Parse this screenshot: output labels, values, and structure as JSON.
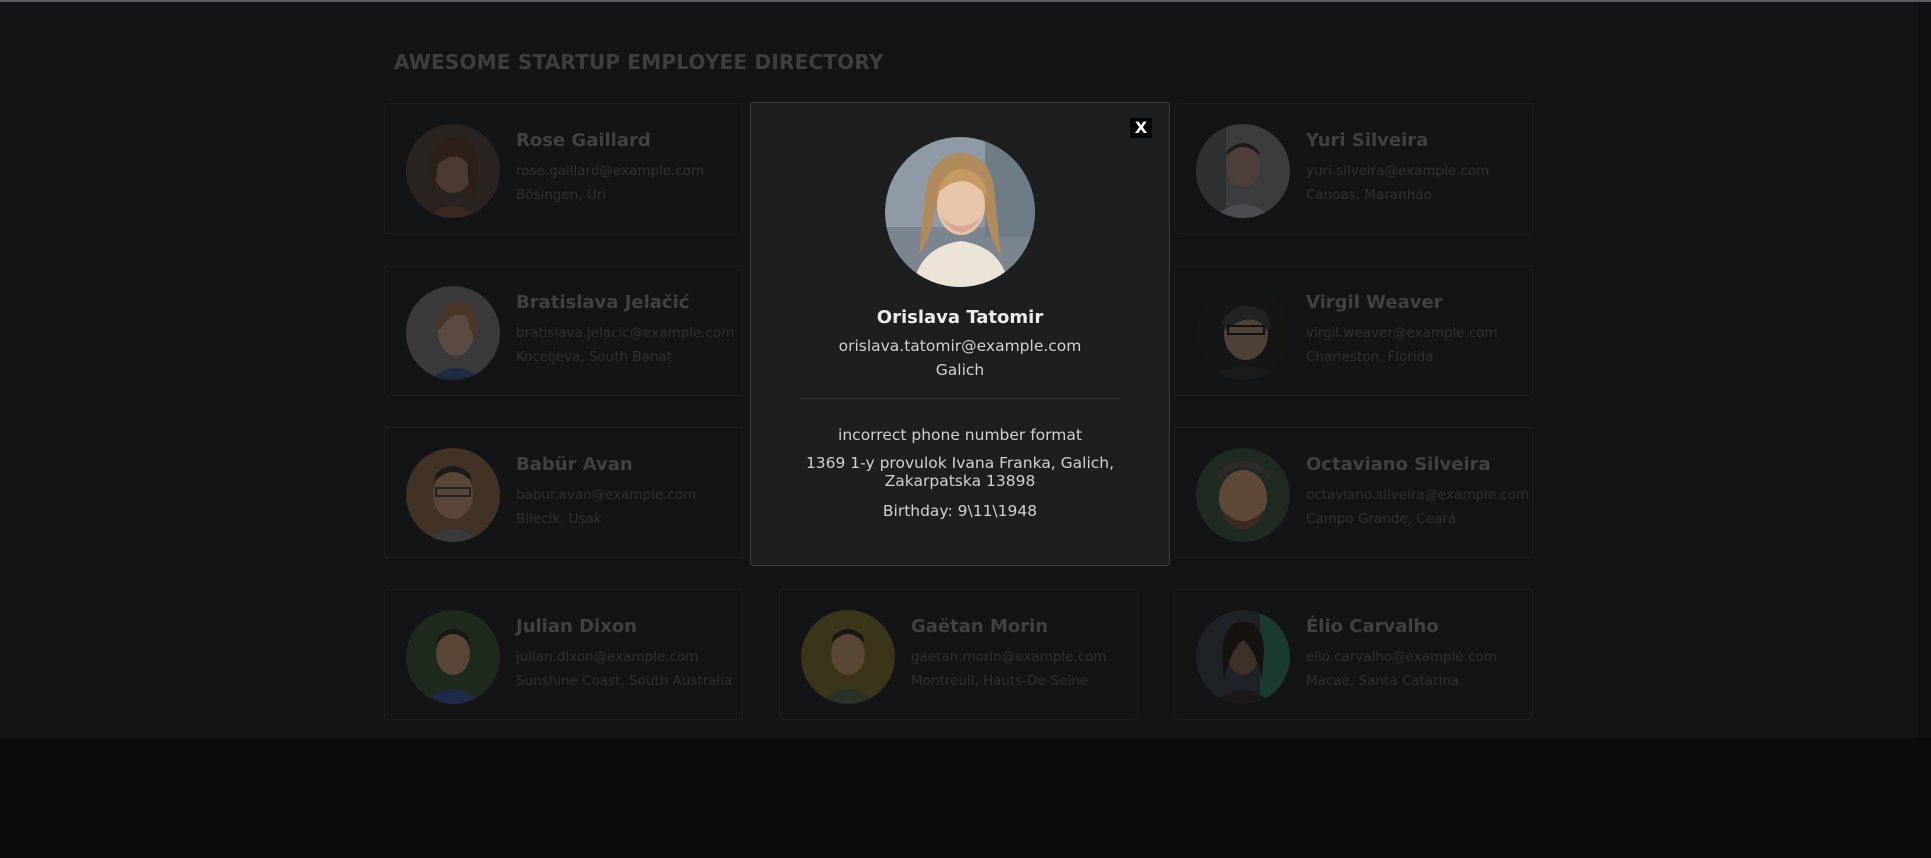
{
  "header": {
    "title": "AWESOME STARTUP EMPLOYEE DIRECTORY"
  },
  "employees": [
    {
      "name": "Rose Gaillard",
      "email": "rose.gaillard@example.com",
      "location": "Bösingen, Uri"
    },
    {
      "name": "",
      "email": "",
      "location": ""
    },
    {
      "name": "Yuri Silveira",
      "email": "yuri.silveira@example.com",
      "location": "Canoas, Maranhão"
    },
    {
      "name": "Bratislava Jelačić",
      "email": "bratislava.jelacic@example.com",
      "location": "Koceljeva, South Banat"
    },
    {
      "name": "",
      "email": "",
      "location": ""
    },
    {
      "name": "Virgil Weaver",
      "email": "virgil.weaver@example.com",
      "location": "Charleston, Florida"
    },
    {
      "name": "Babür Avan",
      "email": "babur.avan@example.com",
      "location": "Bilecik, Uşak"
    },
    {
      "name": "",
      "email": "",
      "location": ""
    },
    {
      "name": "Octaviano Silveira",
      "email": "octaviano.silveira@example.com",
      "location": "Campo Grande, Ceará"
    },
    {
      "name": "Julian Dixon",
      "email": "julian.dixon@example.com",
      "location": "Sunshine Coast, South Australia"
    },
    {
      "name": "Gaëtan Morin",
      "email": "gaetan.morin@example.com",
      "location": "Montreuil, Hauts-De-Seine"
    },
    {
      "name": "Élio Carvalho",
      "email": "elio.carvalho@example.com",
      "location": "Macaé, Santa Catarina"
    }
  ],
  "modal": {
    "close_label": "X",
    "name": "Orislava Tatomir",
    "email": "orislava.tatomir@example.com",
    "city": "Galich",
    "phone": "incorrect phone number format",
    "address": "1369 1-y provulok Ivana Franka, Galich, Zakarpatska 13898",
    "birthday": "Birthday: 9\\11\\1948"
  },
  "colors": {
    "page_bg": "#121416",
    "modal_bg": "#1c1e20",
    "modal_text": "#cfd1d3",
    "close_bg": "#000000"
  }
}
